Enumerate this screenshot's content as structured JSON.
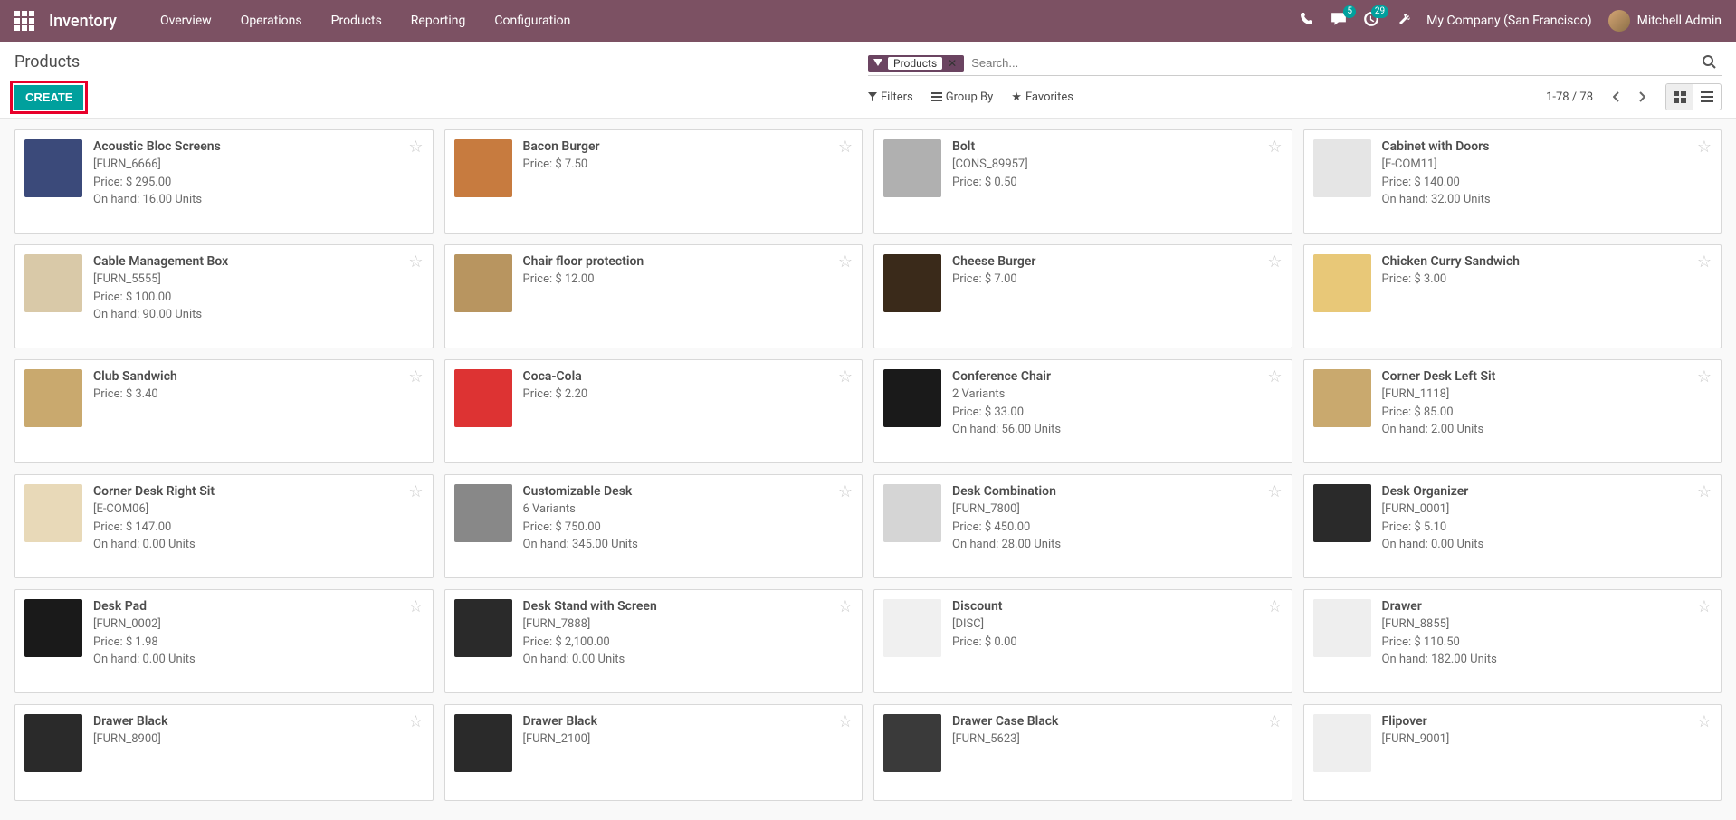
{
  "navbar": {
    "app_title": "Inventory",
    "menu": [
      "Overview",
      "Operations",
      "Products",
      "Reporting",
      "Configuration"
    ],
    "messages_badge": "5",
    "activities_badge": "29",
    "company": "My Company (San Francisco)",
    "user": "Mitchell Admin"
  },
  "control_panel": {
    "breadcrumb": "Products",
    "search_tag_prefix": "",
    "search_tag_label": "Products",
    "search_placeholder": "Search...",
    "create_label": "Create",
    "filters_label": "Filters",
    "groupby_label": "Group By",
    "favorites_label": "Favorites",
    "pager": "1-78 / 78"
  },
  "products": [
    {
      "name": "Acoustic Bloc Screens",
      "ref": "[FURN_6666]",
      "price": "$ 295.00",
      "onhand": "16.00 Units",
      "variants": "",
      "img_color": "#3b4a7a"
    },
    {
      "name": "Bacon Burger",
      "ref": "",
      "price": "$ 7.50",
      "onhand": "",
      "variants": "",
      "img_color": "#c77b3f"
    },
    {
      "name": "Bolt",
      "ref": "[CONS_89957]",
      "price": "$ 0.50",
      "onhand": "",
      "variants": "",
      "img_color": "#b0b0b0"
    },
    {
      "name": "Cabinet with Doors",
      "ref": "[E-COM11]",
      "price": "$ 140.00",
      "onhand": "32.00 Units",
      "variants": "",
      "img_color": "#e5e5e5"
    },
    {
      "name": "Cable Management Box",
      "ref": "[FURN_5555]",
      "price": "$ 100.00",
      "onhand": "90.00 Units",
      "variants": "",
      "img_color": "#d9c9a8"
    },
    {
      "name": "Chair floor protection",
      "ref": "",
      "price": "$ 12.00",
      "onhand": "",
      "variants": "",
      "img_color": "#b89560"
    },
    {
      "name": "Cheese Burger",
      "ref": "",
      "price": "$ 7.00",
      "onhand": "",
      "variants": "",
      "img_color": "#3a2a1a"
    },
    {
      "name": "Chicken Curry Sandwich",
      "ref": "",
      "price": "$ 3.00",
      "onhand": "",
      "variants": "",
      "img_color": "#e8c878"
    },
    {
      "name": "Club Sandwich",
      "ref": "",
      "price": "$ 3.40",
      "onhand": "",
      "variants": "",
      "img_color": "#c9a96e"
    },
    {
      "name": "Coca-Cola",
      "ref": "",
      "price": "$ 2.20",
      "onhand": "",
      "variants": "",
      "img_color": "#d33"
    },
    {
      "name": "Conference Chair",
      "ref": "",
      "price": "$ 33.00",
      "onhand": "56.00 Units",
      "variants": "2 Variants",
      "img_color": "#1a1a1a"
    },
    {
      "name": "Corner Desk Left Sit",
      "ref": "[FURN_1118]",
      "price": "$ 85.00",
      "onhand": "2.00 Units",
      "variants": "",
      "img_color": "#c9a96e"
    },
    {
      "name": "Corner Desk Right Sit",
      "ref": "[E-COM06]",
      "price": "$ 147.00",
      "onhand": "0.00 Units",
      "variants": "",
      "img_color": "#e8d9b8"
    },
    {
      "name": "Customizable Desk",
      "ref": "",
      "price": "$ 750.00",
      "onhand": "345.00 Units",
      "variants": "6 Variants",
      "img_color": "#888"
    },
    {
      "name": "Desk Combination",
      "ref": "[FURN_7800]",
      "price": "$ 450.00",
      "onhand": "28.00 Units",
      "variants": "",
      "img_color": "#d5d5d5"
    },
    {
      "name": "Desk Organizer",
      "ref": "[FURN_0001]",
      "price": "$ 5.10",
      "onhand": "0.00 Units",
      "variants": "",
      "img_color": "#2a2a2a"
    },
    {
      "name": "Desk Pad",
      "ref": "[FURN_0002]",
      "price": "$ 1.98",
      "onhand": "0.00 Units",
      "variants": "",
      "img_color": "#1a1a1a"
    },
    {
      "name": "Desk Stand with Screen",
      "ref": "[FURN_7888]",
      "price": "$ 2,100.00",
      "onhand": "0.00 Units",
      "variants": "",
      "img_color": "#2a2a2a"
    },
    {
      "name": "Discount",
      "ref": "[DISC]",
      "price": "$ 0.00",
      "onhand": "",
      "variants": "",
      "img_color": "#f0f0f0"
    },
    {
      "name": "Drawer",
      "ref": "[FURN_8855]",
      "price": "$ 110.50",
      "onhand": "182.00 Units",
      "variants": "",
      "img_color": "#eee"
    },
    {
      "name": "Drawer Black",
      "ref": "[FURN_8900]",
      "price": "",
      "onhand": "",
      "variants": "",
      "img_color": "#2a2a2a"
    },
    {
      "name": "Drawer Black",
      "ref": "[FURN_2100]",
      "price": "",
      "onhand": "",
      "variants": "",
      "img_color": "#2a2a2a"
    },
    {
      "name": "Drawer Case Black",
      "ref": "[FURN_5623]",
      "price": "",
      "onhand": "",
      "variants": "",
      "img_color": "#3a3a3a"
    },
    {
      "name": "Flipover",
      "ref": "[FURN_9001]",
      "price": "",
      "onhand": "",
      "variants": "",
      "img_color": "#eee"
    }
  ],
  "labels": {
    "price_prefix": "Price: ",
    "onhand_prefix": "On hand: "
  }
}
